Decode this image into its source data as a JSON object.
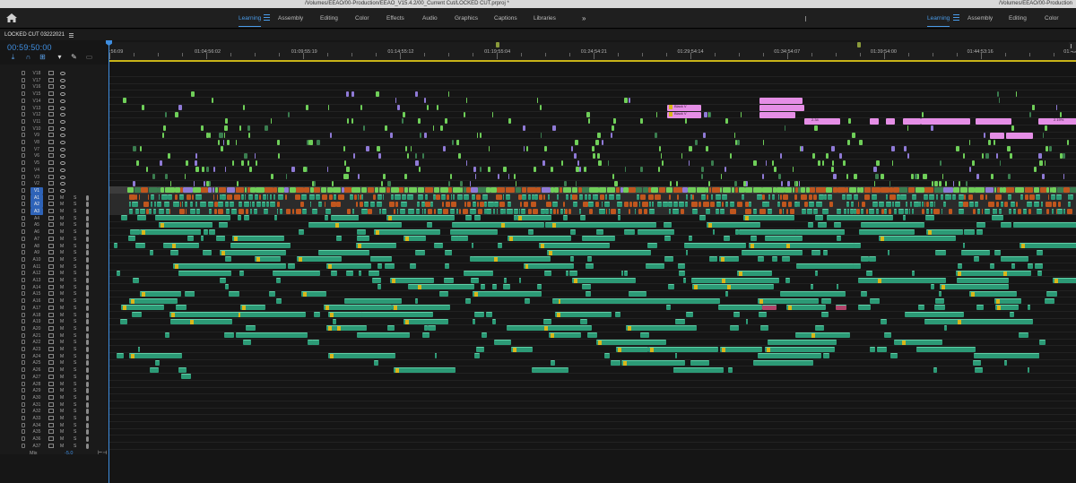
{
  "window": {
    "title": "/Volumes/EEAO/00-Production/EEAO_V15.4.2/00_Current Cut/LOCKED CUT.prproj *",
    "right_title": "/Volumes/EEAO/00-Production"
  },
  "workspaces": {
    "tabs": [
      "Learning",
      "Assembly",
      "Editing",
      "Color",
      "Effects",
      "Audio",
      "Graphics",
      "Captions",
      "Libraries"
    ],
    "active": "Learning",
    "overflow_glyph": "»",
    "secondary_tabs": [
      "Learning",
      "Assembly",
      "Editing",
      "Color"
    ],
    "secondary_active": "Learning"
  },
  "sequence": {
    "name": "LOCKED CUT 03222021",
    "timecode": "00:59:50:00"
  },
  "ruler": {
    "first_tc": ":56:09",
    "timecodes": [
      "01:04:56:02",
      "01:09:55:19",
      "01:14:55:12",
      "01:19:55:04",
      "01:24:54:21",
      "01:29:54:14",
      "01:34:54:07",
      "01:39:54:00",
      "01:44:53:16",
      "01:49"
    ]
  },
  "tracks": {
    "video": [
      "V18",
      "V17",
      "V16",
      "V15",
      "V14",
      "V13",
      "V12",
      "V11",
      "V10",
      "V9",
      "V8",
      "V7",
      "V6",
      "V5",
      "V4",
      "V3",
      "V2",
      "V1"
    ],
    "audio": [
      "A1",
      "A2",
      "A3",
      "A4",
      "A5",
      "A6",
      "A7",
      "A8",
      "A9",
      "A10",
      "A11",
      "A12",
      "A13",
      "A14",
      "A15",
      "A16",
      "A17",
      "A18",
      "A19",
      "A20",
      "A21",
      "A22",
      "A23",
      "A24",
      "A25",
      "A26",
      "A27",
      "A28",
      "A29",
      "A30",
      "A31",
      "A32",
      "A33",
      "A34",
      "A35",
      "A36",
      "A37"
    ],
    "targeted": [
      "V1",
      "A1",
      "A2",
      "A3"
    ],
    "mute_label": "M",
    "solo_label": "S"
  },
  "mix": {
    "label": "Mix",
    "value": "-5.0"
  },
  "clip_labels": {
    "black_video": "Black V",
    "speed_a": "2.34",
    "speed_b": "2.19%"
  },
  "colors": {
    "audio_clip": "#2c9a76",
    "video_clip": "#6fcf59",
    "video_clip_orange": "#c0561e",
    "adjustment_pink": "#e58ee6",
    "playhead": "#3f8ee0",
    "work_area": "#c8b418",
    "fx_badge": "#d9b61a"
  },
  "icons": [
    "home-icon",
    "hamburger-menu-icon",
    "snap-icon",
    "linked-selection-icon",
    "add-marker-icon",
    "settings-wrench-icon",
    "captions-icon",
    "lock-icon",
    "sync-lock-icon",
    "eye-icon",
    "voiceover-mic-icon"
  ]
}
